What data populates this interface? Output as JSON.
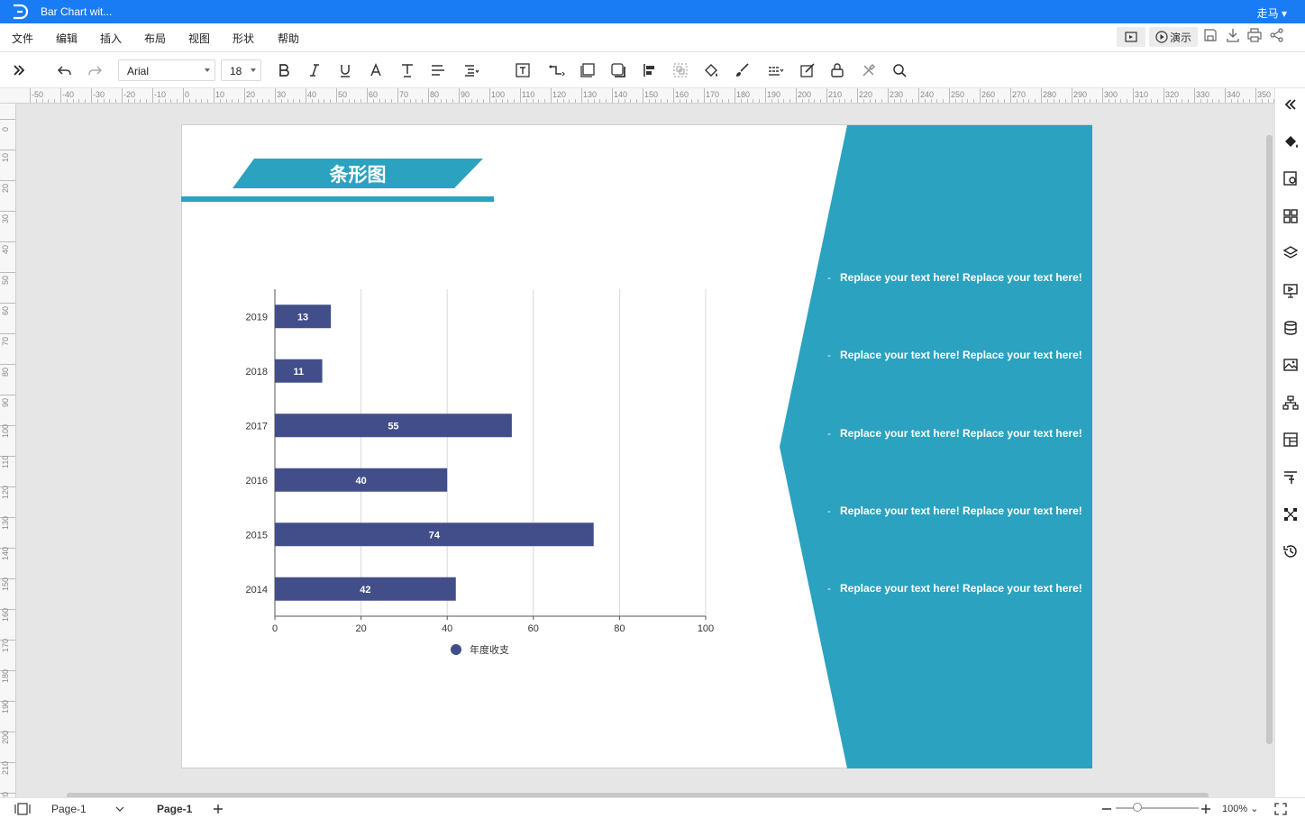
{
  "window": {
    "title": "Bar Chart wit...",
    "user": "走马"
  },
  "menu": [
    "文件",
    "编辑",
    "插入",
    "布局",
    "视图",
    "形状",
    "帮助"
  ],
  "right_tools": {
    "present_label": "演示"
  },
  "toolbar": {
    "font_family": "Arial",
    "font_size": "18"
  },
  "ruler_top": [
    "-50",
    "-40",
    "-30",
    "-20",
    "-10",
    "0",
    "10",
    "20",
    "30",
    "40",
    "50",
    "60",
    "70",
    "80",
    "90",
    "100",
    "110",
    "120",
    "130",
    "140",
    "150",
    "160",
    "170",
    "180",
    "190",
    "200",
    "210",
    "220",
    "230",
    "240",
    "250",
    "260",
    "270",
    "280",
    "290",
    "300",
    "310",
    "320",
    "330",
    "340",
    "350"
  ],
  "ruler_left": [
    "0",
    "10",
    "20",
    "30",
    "40",
    "50",
    "60",
    "70",
    "80",
    "90",
    "100",
    "110",
    "120",
    "130",
    "140",
    "150",
    "160",
    "170",
    "180",
    "190",
    "200",
    "210",
    "220"
  ],
  "slide": {
    "title": "条形图",
    "bullets": [
      "Replace your text here!  Replace your text here!",
      "Replace your text here!  Replace your text here!",
      "Replace your text here!  Replace your text here!",
      "Replace your text here!  Replace your text here!",
      "Replace your text here!  Replace your text here!"
    ]
  },
  "chart_data": {
    "type": "bar",
    "orientation": "horizontal",
    "categories": [
      "2019",
      "2018",
      "2017",
      "2016",
      "2015",
      "2014"
    ],
    "series": [
      {
        "name": "年度收支",
        "values": [
          13,
          11,
          55,
          40,
          74,
          42
        ],
        "color": "#414e89"
      }
    ],
    "xlim": [
      0,
      100
    ],
    "xticks": [
      "0",
      "20",
      "40",
      "60",
      "80",
      "100"
    ],
    "grid": true,
    "legend_position": "bottom"
  },
  "colors": {
    "accent": "#2ba2bf",
    "bar": "#414e89",
    "titlebar": "#1a7cf4"
  },
  "statusbar": {
    "page_selector": "Page-1",
    "active_page": "Page-1",
    "zoom": "100%"
  }
}
